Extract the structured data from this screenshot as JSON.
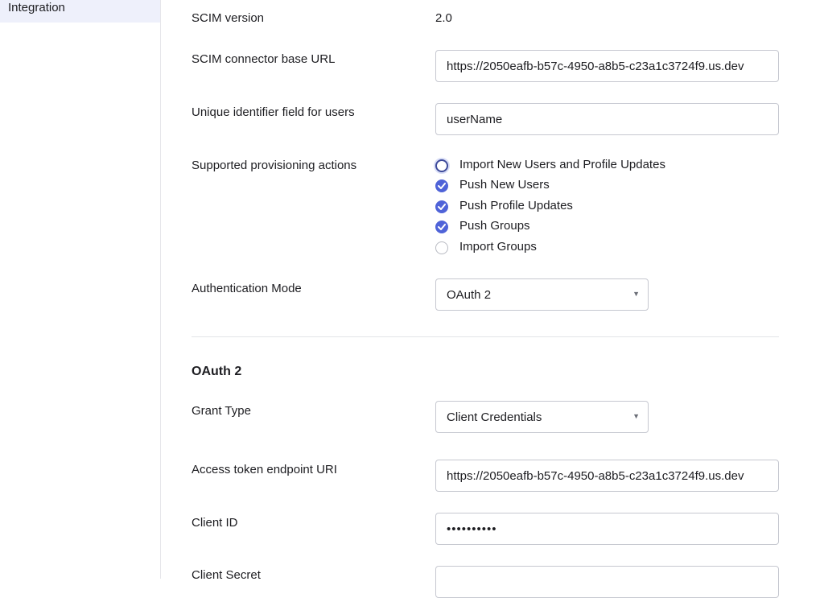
{
  "sidebar": {
    "items": [
      {
        "label": "Integration"
      }
    ]
  },
  "form": {
    "scim_version": {
      "label": "SCIM version",
      "value": "2.0"
    },
    "base_url": {
      "label": "SCIM connector base URL",
      "value": "https://2050eafb-b57c-4950-a8b5-c23a1c3724f9.us.dev"
    },
    "unique_id": {
      "label": "Unique identifier field for users",
      "value": "userName"
    },
    "provisioning": {
      "label": "Supported provisioning actions",
      "options": [
        {
          "label": "Import New Users and Profile Updates",
          "checked": false
        },
        {
          "label": "Push New Users",
          "checked": true
        },
        {
          "label": "Push Profile Updates",
          "checked": true
        },
        {
          "label": "Push Groups",
          "checked": true
        },
        {
          "label": "Import Groups",
          "checked": false
        }
      ]
    },
    "auth_mode": {
      "label": "Authentication Mode",
      "value": "OAuth 2"
    }
  },
  "oauth": {
    "section_title": "OAuth 2",
    "grant_type": {
      "label": "Grant Type",
      "value": "Client Credentials"
    },
    "token_endpoint": {
      "label": "Access token endpoint URI",
      "value": "https://2050eafb-b57c-4950-a8b5-c23a1c3724f9.us.dev"
    },
    "client_id": {
      "label": "Client ID",
      "value": "••••••••••"
    },
    "client_secret": {
      "label": "Client Secret",
      "value": ""
    }
  },
  "colors": {
    "accent": "#4f63d8",
    "sidebar_active": "#eef0fb"
  },
  "icons": {
    "checkmark": "checkmark-icon",
    "dropdown": "chevron-down-icon"
  }
}
